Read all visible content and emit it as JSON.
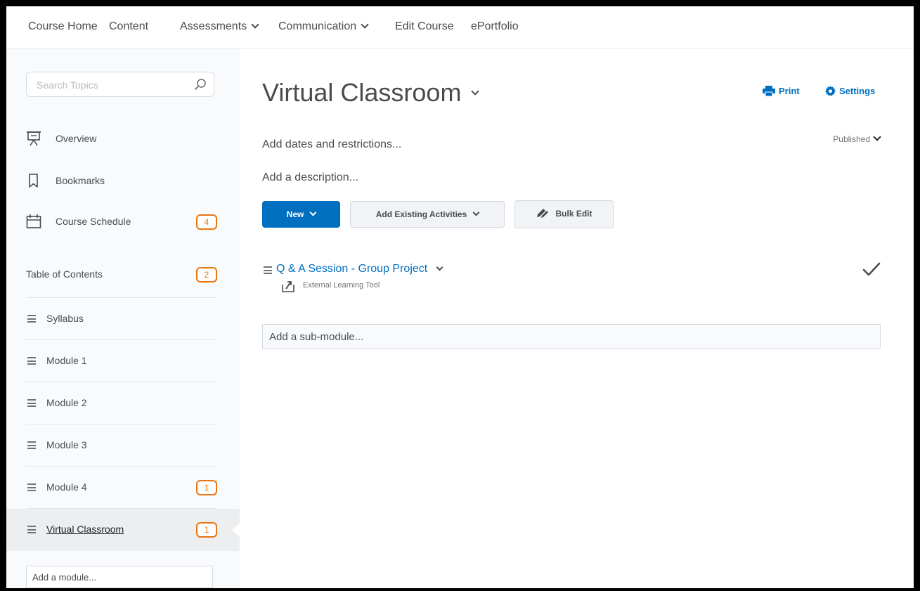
{
  "topnav": {
    "items": [
      {
        "label": "Course Home",
        "dropdown": false
      },
      {
        "label": "Content",
        "dropdown": false
      },
      {
        "label": "Assessments",
        "dropdown": true
      },
      {
        "label": "Communication",
        "dropdown": true
      },
      {
        "label": "Edit Course",
        "dropdown": false
      },
      {
        "label": "ePortfolio",
        "dropdown": false
      }
    ]
  },
  "sidebar": {
    "search_placeholder": "Search Topics",
    "overview": "Overview",
    "bookmarks": "Bookmarks",
    "course_schedule": {
      "label": "Course Schedule",
      "badge": "4"
    },
    "toc": {
      "label": "Table of Contents",
      "badge": "2"
    },
    "modules": [
      {
        "label": "Syllabus",
        "badge": ""
      },
      {
        "label": "Module 1",
        "badge": ""
      },
      {
        "label": "Module 2",
        "badge": ""
      },
      {
        "label": "Module 3",
        "badge": ""
      },
      {
        "label": "Module 4",
        "badge": "1"
      },
      {
        "label": "Virtual Classroom",
        "badge": "1",
        "active": true
      }
    ],
    "add_module": "Add a module..."
  },
  "main": {
    "title": "Virtual Classroom",
    "print": "Print",
    "settings": "Settings",
    "dates": "Add dates and restrictions...",
    "status": "Published",
    "description": "Add a description...",
    "buttons": {
      "new": "New",
      "add_existing": "Add Existing Activities",
      "bulk_edit": "Bulk Edit"
    },
    "topic": {
      "title": "Q & A Session - Group Project",
      "type": "External Learning Tool"
    },
    "add_submodule": "Add a sub-module..."
  },
  "colors": {
    "accent": "#006fbf",
    "badge": "#e87511",
    "text": "#494c4e"
  }
}
